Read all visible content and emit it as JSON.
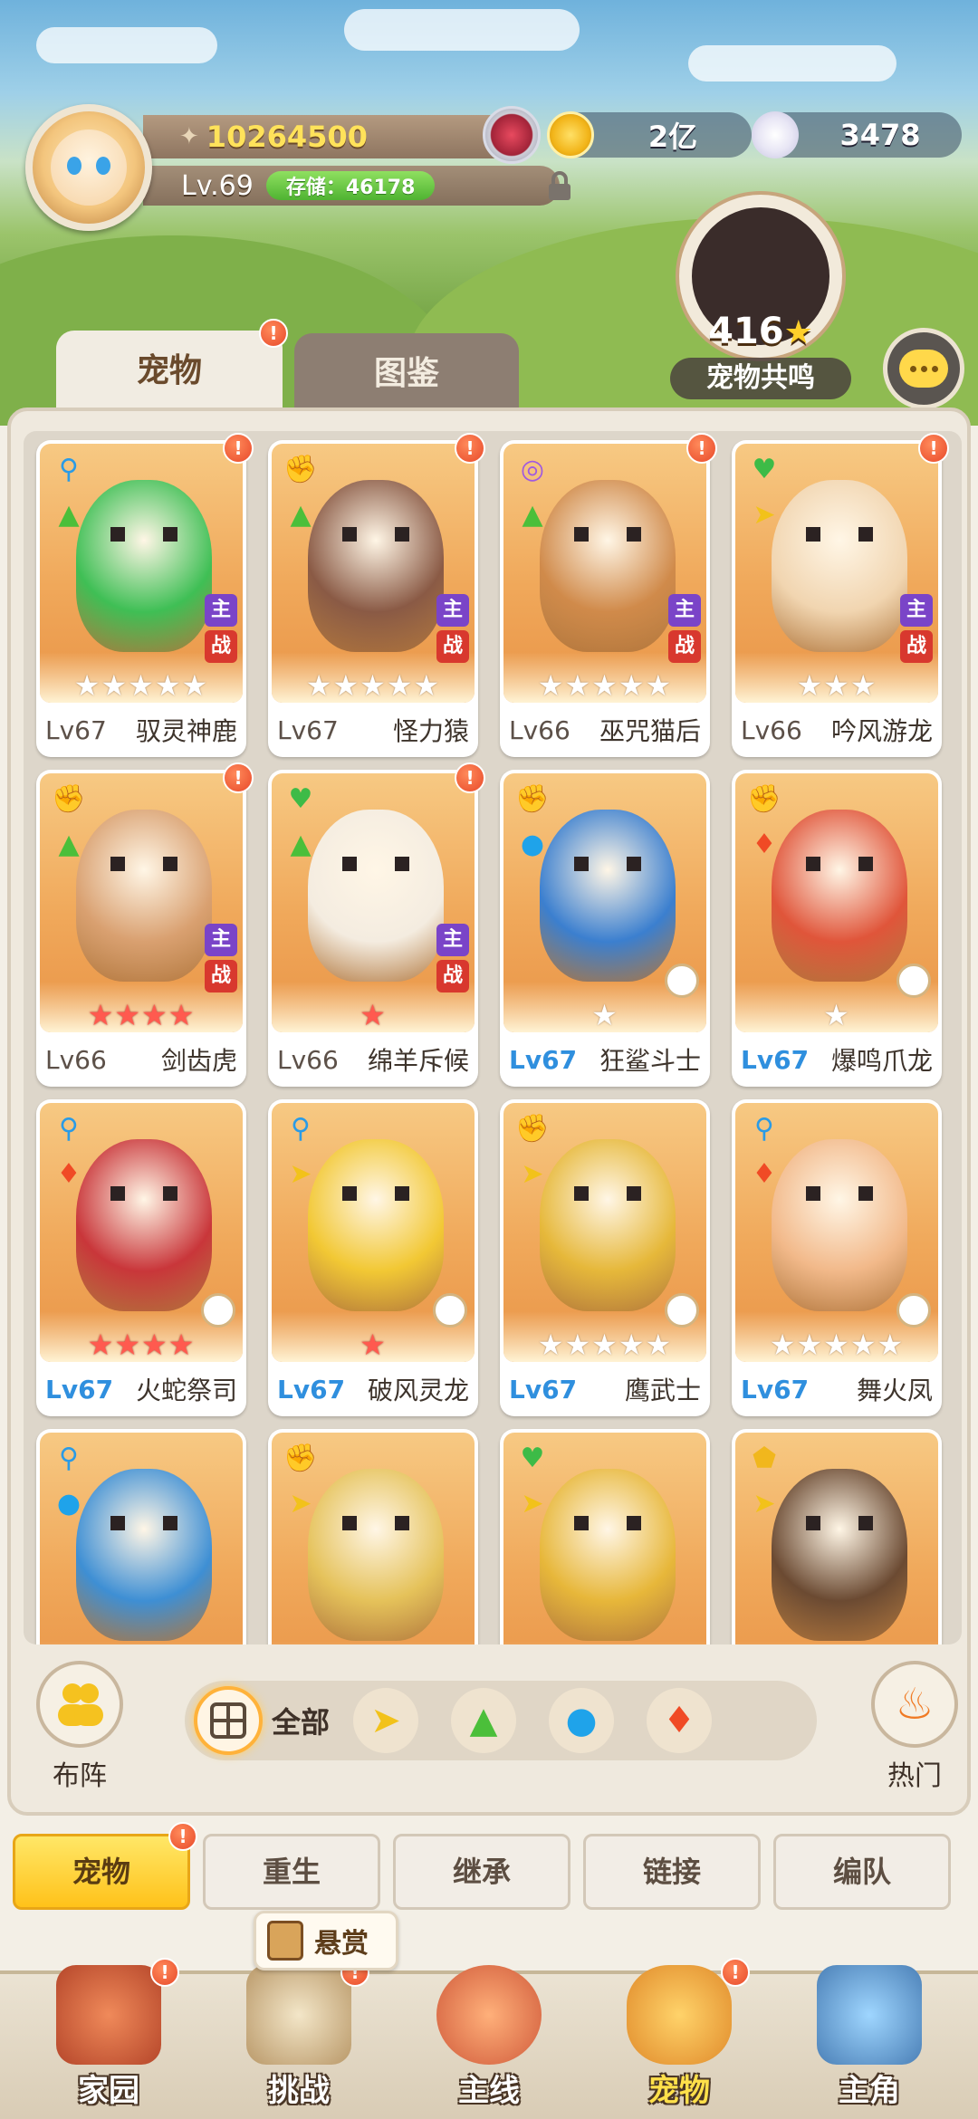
{
  "player": {
    "power": "10264500",
    "level": "Lv.69",
    "storage": "存储：46178"
  },
  "currency": {
    "gold": "2亿",
    "shell": "3478"
  },
  "resonance": {
    "count": "416",
    "label": "宠物共鸣"
  },
  "tabs": {
    "pets": "宠物",
    "dex": "图鉴"
  },
  "pets": [
    {
      "level": "Lv67",
      "name": "驭灵神鹿",
      "stars": 5,
      "starred": 0,
      "main": true,
      "role_icon": "key-icon",
      "element": "earth",
      "color": "#3fbf55"
    },
    {
      "level": "Lv67",
      "name": "怪力猿",
      "stars": 5,
      "starred": 0,
      "main": true,
      "role_icon": "fist-icon",
      "element": "earth",
      "color": "#8a5a45"
    },
    {
      "level": "Lv66",
      "name": "巫咒猫后",
      "stars": 5,
      "starred": 0,
      "main": true,
      "role_icon": "swirl-icon",
      "element": "earth",
      "color": "#d08a4a"
    },
    {
      "level": "Lv66",
      "name": "吟风游龙",
      "stars": 3,
      "starred": 0,
      "main": true,
      "role_icon": "heart-icon",
      "element": "wind",
      "color": "#f1d5b0"
    },
    {
      "level": "Lv66",
      "name": "剑齿虎",
      "stars": 4,
      "starred": 4,
      "main": true,
      "role_icon": "fist-icon",
      "element": "earth",
      "color": "#d9a070"
    },
    {
      "level": "Lv66",
      "name": "绵羊斥候",
      "stars": 1,
      "starred": 1,
      "main": true,
      "role_icon": "heart-icon",
      "element": "earth",
      "color": "#f4ece0"
    },
    {
      "level": "Lv67",
      "name": "狂鲨斗士",
      "stars": 1,
      "starred": 0,
      "main": false,
      "role_icon": "fist-icon",
      "element": "water",
      "color": "#3b7fcf"
    },
    {
      "level": "Lv67",
      "name": "爆鸣爪龙",
      "stars": 1,
      "starred": 0,
      "main": false,
      "role_icon": "fist-icon",
      "element": "fire",
      "color": "#e0553a"
    },
    {
      "level": "Lv67",
      "name": "火蛇祭司",
      "stars": 4,
      "starred": 4,
      "main": false,
      "role_icon": "key-icon",
      "element": "fire",
      "color": "#c9363a"
    },
    {
      "level": "Lv67",
      "name": "破风灵龙",
      "stars": 1,
      "starred": 1,
      "main": false,
      "role_icon": "key-icon",
      "element": "wind",
      "color": "#f2c834"
    },
    {
      "level": "Lv67",
      "name": "鹰武士",
      "stars": 5,
      "starred": 0,
      "main": false,
      "role_icon": "fist-icon",
      "element": "wind",
      "color": "#e6b83a"
    },
    {
      "level": "Lv67",
      "name": "舞火凤",
      "stars": 5,
      "starred": 0,
      "main": false,
      "role_icon": "key-icon",
      "element": "fire",
      "color": "#f2b98a"
    },
    {
      "level": "",
      "name": "",
      "stars": 0,
      "starred": 0,
      "main": false,
      "role_icon": "key-icon",
      "element": "water",
      "color": "#3e8fd4"
    },
    {
      "level": "",
      "name": "",
      "stars": 0,
      "starred": 0,
      "main": false,
      "role_icon": "fist-icon",
      "element": "wind",
      "color": "#e5c25a"
    },
    {
      "level": "",
      "name": "",
      "stars": 0,
      "starred": 0,
      "main": false,
      "role_icon": "heart-icon",
      "element": "wind",
      "color": "#e7b73a"
    },
    {
      "level": "",
      "name": "",
      "stars": 0,
      "starred": 0,
      "main": false,
      "role_icon": "shield-icon",
      "element": "wind",
      "color": "#6b4a32"
    }
  ],
  "tags": {
    "main": "主",
    "battle": "战"
  },
  "filters": {
    "formation": "布阵",
    "all": "全部",
    "hot": "热门"
  },
  "subnav": [
    "宠物",
    "重生",
    "继承",
    "链接",
    "编队"
  ],
  "bounty": "悬赏",
  "bottom_tabs": [
    "家园",
    "挑战",
    "主线",
    "宠物",
    "主角"
  ],
  "badge_mark": "!"
}
